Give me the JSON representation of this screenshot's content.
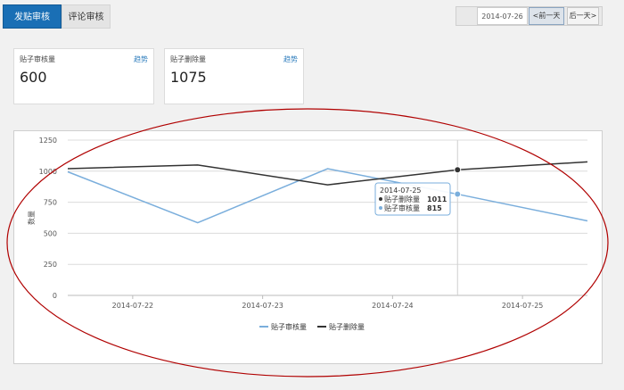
{
  "tabs": [
    {
      "label": "发贴审核",
      "active": true
    },
    {
      "label": "评论审核",
      "active": false
    }
  ],
  "date_nav": {
    "date_value": "2014-07-26",
    "prev_label": "<前一天",
    "next_label": "后一天>"
  },
  "cards": [
    {
      "title": "贴子审核量",
      "trend_label": "趋势",
      "value": "600"
    },
    {
      "title": "贴子删除量",
      "trend_label": "趋势",
      "value": "1075"
    }
  ],
  "chart_data": {
    "type": "line",
    "ylabel": "数量",
    "ylim": [
      0,
      1250
    ],
    "y_ticks": [
      0,
      250,
      500,
      750,
      1000,
      1250
    ],
    "x_ticks": [
      "2014-07-22",
      "2014-07-23",
      "2014-07-24",
      "2014-07-25"
    ],
    "series": [
      {
        "name": "贴子审核量",
        "color": "#7aaedc",
        "points": [
          [
            0,
            995
          ],
          [
            1,
            585
          ],
          [
            2,
            1020
          ],
          [
            3,
            815
          ],
          [
            4,
            600
          ]
        ]
      },
      {
        "name": "贴子删除量",
        "color": "#333333",
        "points": [
          [
            0,
            1020
          ],
          [
            1,
            1050
          ],
          [
            2,
            890
          ],
          [
            3,
            1011
          ],
          [
            4,
            1075
          ]
        ]
      }
    ],
    "grid": true,
    "legend_position": "bottom",
    "tooltip": {
      "x_index": 3,
      "header": "2014-07-25",
      "lines": [
        {
          "label": "贴子删除量",
          "value": "1011"
        },
        {
          "label": "贴子审核量",
          "value": "815"
        }
      ]
    }
  },
  "annotation": {
    "shape": "ellipse",
    "color": "#b00000"
  }
}
